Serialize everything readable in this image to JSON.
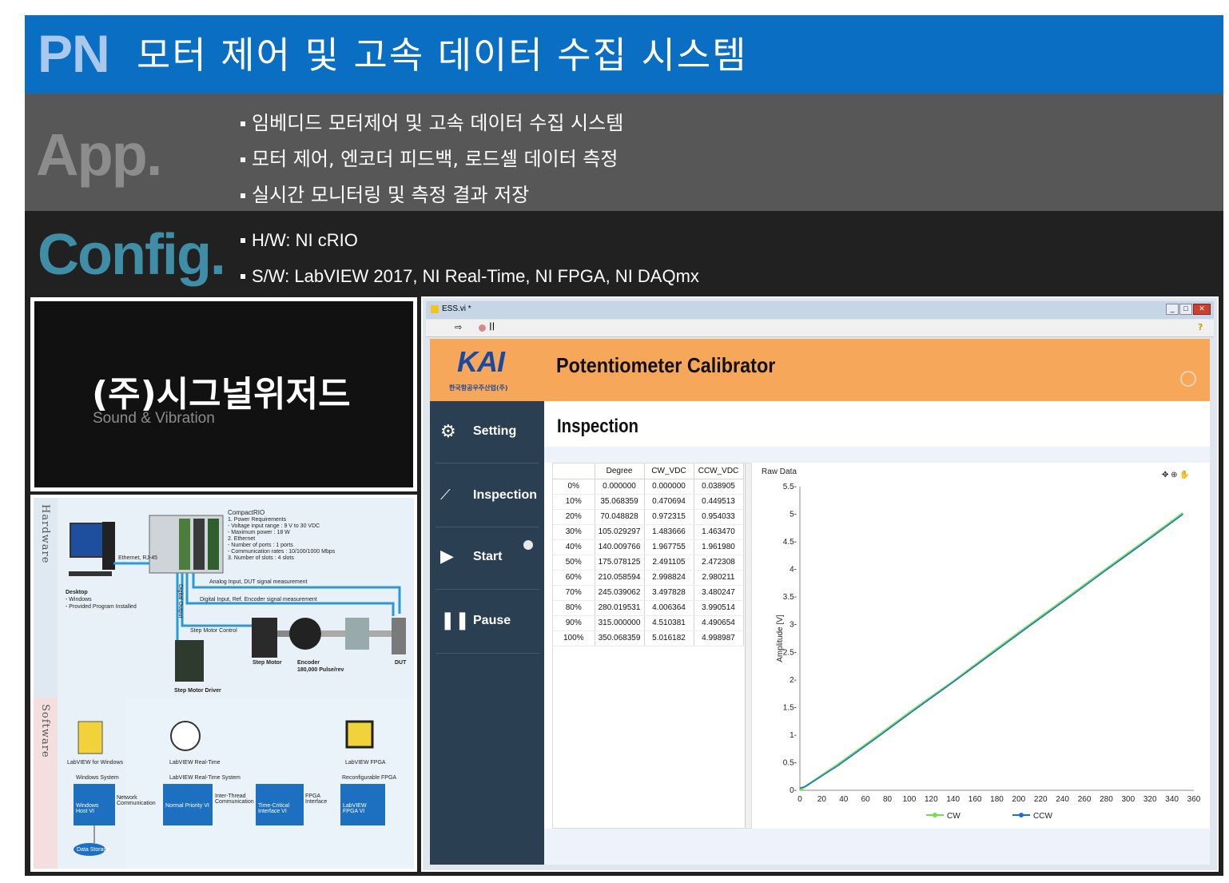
{
  "header": {
    "prefix": "PN",
    "title": "모터 제어 및 고속 데이터 수집 시스템"
  },
  "app": {
    "label": "App.",
    "bullets": [
      "임베디드 모터제어 및 고속 데이터 수집 시스템",
      "모터 제어, 엔코더 피드백, 로드셀 데이터 측정",
      "실시간 모니터링 및 측정 결과 저장"
    ]
  },
  "config": {
    "label": "Config.",
    "bullets": [
      "H/W: NI cRIO",
      "S/W: LabVIEW 2017, NI Real-Time, NI FPGA, NI DAQmx"
    ]
  },
  "logo_panel": {
    "company": "(주)시그널위저드",
    "tagline": "Sound & Vibration"
  },
  "diagram": {
    "hardware_label": "Hardware",
    "software_label": "Software",
    "crio_title": "CompactRIO",
    "crio_specs": [
      "1. Power Requirements",
      "- Voltage input range : 9 V to 30 VDC",
      "- Maximum power : 18 W",
      "2. Ethernet",
      "- Number of ports : 1 ports",
      "- Communication rates : 10/100/1000 Mbps",
      "3. Number of slots : 4 slots"
    ],
    "ethernet": "Ethernet, RJ-45",
    "desktop": [
      "Desktop",
      "- Windows",
      "- Provided Program Installed"
    ],
    "digital_output": "Digital Output",
    "analog_input": "Analog Input, DUT signal measurement",
    "digital_input": "Digital Input, Ref. Encoder signal measurement",
    "step_motor_control": "Step Motor Control",
    "step_motor": "Step Motor",
    "encoder": [
      "Encoder",
      "180,000 Pulse/rev"
    ],
    "dut": "DUT",
    "step_motor_driver": "Step Motor Driver",
    "sw_icons": [
      "LabVIEW for Windows",
      "LabVIEW Real-Time",
      "LabVIEW FPGA"
    ],
    "systems": [
      "Windows System",
      "LabVIEW Real-Time System",
      "Reconfigurable FPGA"
    ],
    "blocks": [
      "Windows Host VI",
      "Normal Priority VI",
      "Time-Critical Interface VI",
      "LabVIEW FPGA VI"
    ],
    "links": [
      "Network Communication",
      "Inter-Thread Communication",
      "FPGA Interface"
    ],
    "storage": "Data Storage"
  },
  "window": {
    "file": "ESS.vi *",
    "app_title": "Potentiometer Calibrator",
    "logo_text": "KAI",
    "logo_sub": "한국항공우주산업(주)",
    "section_title": "Inspection",
    "nav": [
      "Setting",
      "Inspection",
      "Start",
      "Pause"
    ],
    "table": {
      "headers": [
        "",
        "Degree",
        "CW_VDC",
        "CCW_VDC"
      ],
      "rows": [
        [
          "0%",
          "0.000000",
          "0.000000",
          "0.038905"
        ],
        [
          "10%",
          "35.068359",
          "0.470694",
          "0.449513"
        ],
        [
          "20%",
          "70.048828",
          "0.972315",
          "0.954033"
        ],
        [
          "30%",
          "105.029297",
          "1.483666",
          "1.463470"
        ],
        [
          "40%",
          "140.009766",
          "1.967755",
          "1.961980"
        ],
        [
          "50%",
          "175.078125",
          "2.491105",
          "2.472308"
        ],
        [
          "60%",
          "210.058594",
          "2.998824",
          "2.980211"
        ],
        [
          "70%",
          "245.039062",
          "3.497828",
          "3.480247"
        ],
        [
          "80%",
          "280.019531",
          "4.006364",
          "3.990514"
        ],
        [
          "90%",
          "315.000000",
          "4.510381",
          "4.490654"
        ],
        [
          "100%",
          "350.068359",
          "5.016182",
          "4.998987"
        ]
      ]
    }
  },
  "chart_data": {
    "type": "line",
    "title": "Raw Data",
    "xlabel": "",
    "ylabel": "Amplitude [V]",
    "xlim": [
      0,
      360
    ],
    "ylim": [
      0,
      5.5
    ],
    "xticks": [
      "0",
      "20",
      "40",
      "60",
      "80",
      "100",
      "120",
      "140",
      "160",
      "180",
      "200",
      "220",
      "240",
      "260",
      "280",
      "300",
      "320",
      "340",
      "360"
    ],
    "yticks": [
      "0",
      "0.5",
      "1",
      "1.5",
      "2",
      "2.5",
      "3",
      "3.5",
      "4",
      "4.5",
      "5",
      "5.5"
    ],
    "legend_position": "bottom",
    "series": [
      {
        "name": "CW",
        "color": "#6ee04a",
        "x": [
          0,
          5,
          35.07,
          70.05,
          105.03,
          140.01,
          175.08,
          210.06,
          245.04,
          280.02,
          315.0,
          350.07
        ],
        "values": [
          0.0,
          0.07,
          0.47,
          0.97,
          1.48,
          1.97,
          2.49,
          3.0,
          3.5,
          4.01,
          4.51,
          5.02
        ]
      },
      {
        "name": "CCW",
        "color": "#1f6fd1",
        "x": [
          0,
          5,
          35.07,
          70.05,
          105.03,
          140.01,
          175.08,
          210.06,
          245.04,
          280.02,
          315.0,
          350.07
        ],
        "values": [
          0.04,
          0.07,
          0.45,
          0.95,
          1.46,
          1.96,
          2.47,
          2.98,
          3.48,
          3.99,
          4.49,
          5.0
        ]
      }
    ]
  }
}
